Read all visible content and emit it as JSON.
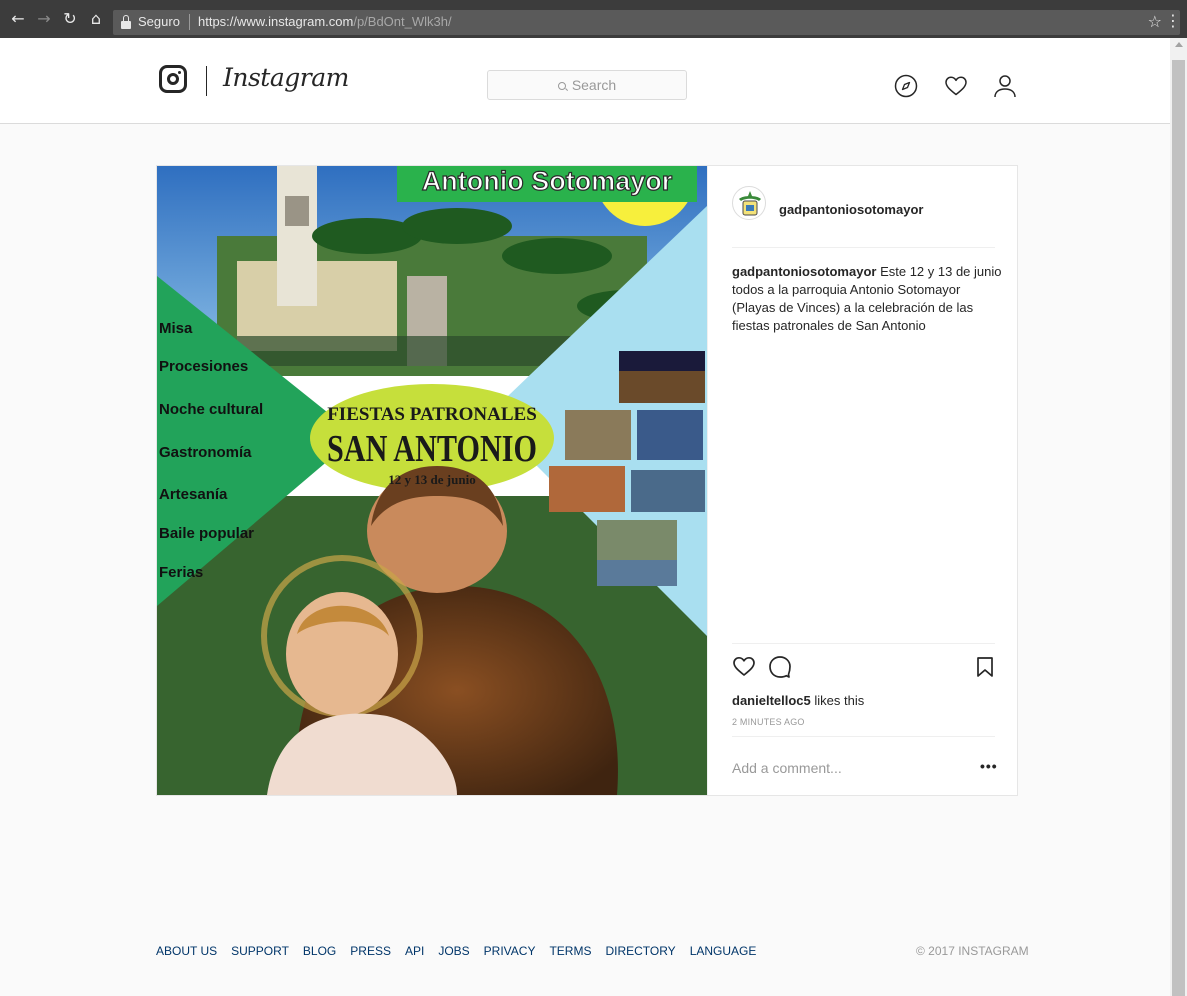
{
  "browser": {
    "secure_label": "Seguro",
    "url_base": "https://www.instagram.com",
    "url_path": "/p/BdOnt_Wlk3h/"
  },
  "header": {
    "wordmark": "Instagram",
    "search_placeholder": "Search"
  },
  "post": {
    "username": "gadpantoniosotomayor",
    "caption_user": "gadpantoniosotomayor",
    "caption_text": " Este 12 y 13 de junio todos a la parroquia Antonio Sotomayor (Playas de Vinces) a la celebración de las fiestas patronales de San Antonio",
    "likes_user": "danieltelloc5",
    "likes_suffix": " likes this",
    "timestamp": "2 MINUTES AGO",
    "comment_placeholder": "Add a comment...",
    "more_label": "•••",
    "image": {
      "banner": "Antonio Sotomayor",
      "event_title_1": "FIESTAS PATRONALES",
      "event_title_2": "SAN ANTONIO",
      "event_dates": "12 y 13 de junio",
      "activities": [
        "Misa",
        "Procesiones",
        "Noche cultural",
        "Gastronomía",
        "Artesanía",
        "Baile popular",
        "Ferias"
      ]
    }
  },
  "footer": {
    "links": [
      "ABOUT US",
      "SUPPORT",
      "BLOG",
      "PRESS",
      "API",
      "JOBS",
      "PRIVACY",
      "TERMS",
      "DIRECTORY",
      "LANGUAGE"
    ],
    "copyright": "© 2017 INSTAGRAM"
  },
  "colors": {
    "link": "#003569",
    "text": "#262626",
    "muted": "#999999",
    "poster_green": "#22a35a",
    "poster_sky": "#a9dff0"
  }
}
